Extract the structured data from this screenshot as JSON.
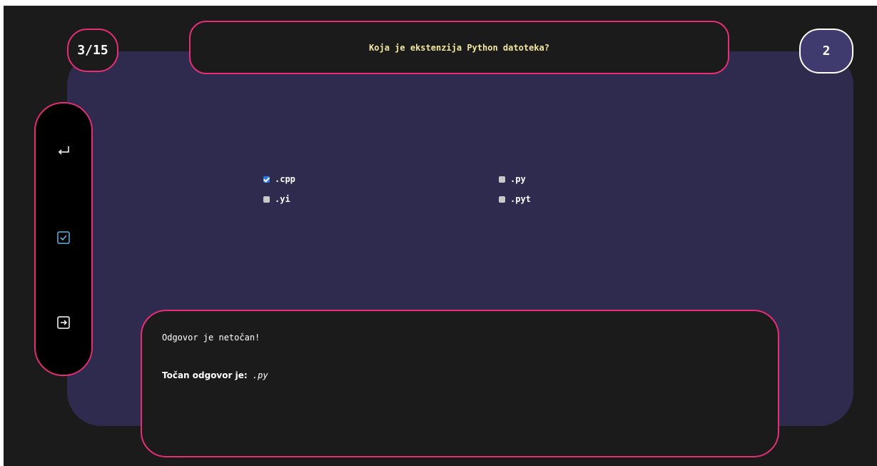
{
  "header": {
    "progress": "3/15",
    "question": "Koja je ekstenzija Python datoteka?",
    "score": "2"
  },
  "sidebar": {
    "items": [
      {
        "icon": "return-arrow-icon"
      },
      {
        "icon": "check-square-icon"
      },
      {
        "icon": "arrow-right-square-icon"
      }
    ]
  },
  "options": [
    {
      "label": ".cpp",
      "checked": true
    },
    {
      "label": ".py",
      "checked": false
    },
    {
      "label": ".yi",
      "checked": false
    },
    {
      "label": ".pyt",
      "checked": false
    }
  ],
  "feedback": {
    "message": "Odgovor je netočan!",
    "correct_label": "Točan odgovor je:",
    "correct_answer": ".py"
  },
  "colors": {
    "accent": "#e62e75",
    "panel": "#2e2b4e",
    "background": "#1b1b1b",
    "question_text": "#f3e7a0",
    "check_blue": "#2d7ce0",
    "icon_blue": "#63b3e0"
  }
}
